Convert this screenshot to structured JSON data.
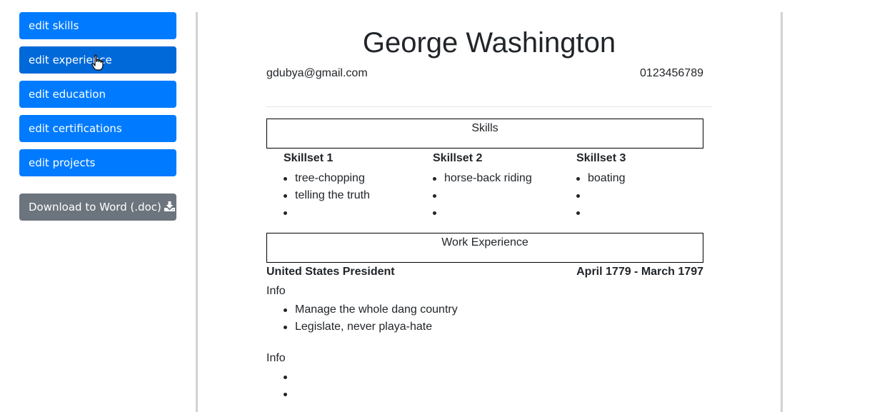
{
  "sidebar": {
    "buttons": [
      {
        "label": "edit skills"
      },
      {
        "label": "edit experience"
      },
      {
        "label": "edit education"
      },
      {
        "label": "edit certifications"
      },
      {
        "label": "edit projects"
      }
    ],
    "download_label": "Download to Word (.doc)"
  },
  "resume": {
    "name": "George Washington",
    "email": "gdubya@gmail.com",
    "phone": "0123456789",
    "skills_section_title": "Skills",
    "skillsets": [
      {
        "title": "Skillset 1",
        "items": [
          "tree-chopping",
          "telling the truth",
          ""
        ]
      },
      {
        "title": "Skillset 2",
        "items": [
          "horse-back riding",
          "",
          ""
        ]
      },
      {
        "title": "Skillset 3",
        "items": [
          "boating",
          "",
          ""
        ]
      }
    ],
    "experience_section_title": "Work Experience",
    "job": {
      "title": "United States President",
      "dates": "April 1779 - March 1797",
      "info_blocks": [
        {
          "label": "Info",
          "items": [
            "Manage the whole dang country",
            "Legislate, never playa-hate"
          ]
        },
        {
          "label": "Info",
          "items": [
            "",
            ""
          ]
        }
      ]
    }
  },
  "colors": {
    "primary": "#007bff",
    "primary_hover": "#0069d9",
    "secondary": "#6c757d"
  }
}
